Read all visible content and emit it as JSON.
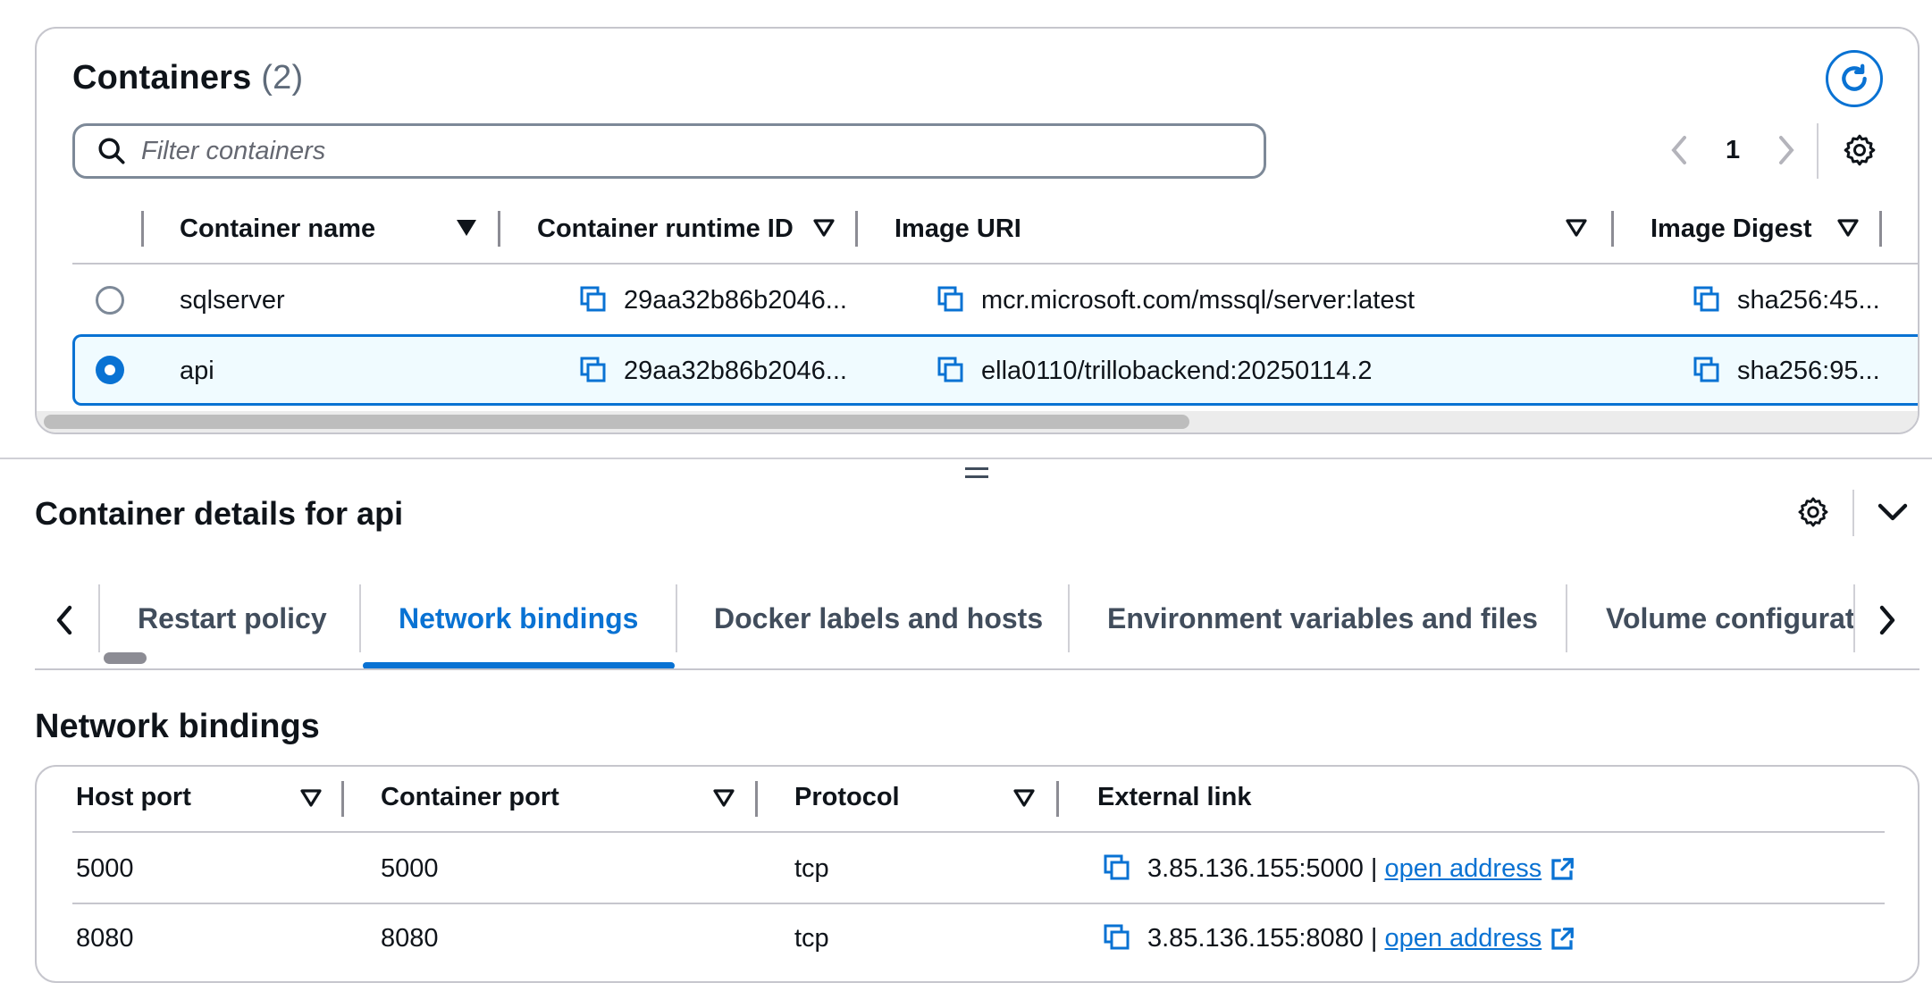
{
  "containers": {
    "title": "Containers",
    "count": "(2)",
    "refresh_icon": "refresh-icon",
    "filter": {
      "placeholder": "Filter containers",
      "value": ""
    },
    "pagination": {
      "current_page": "1"
    },
    "columns": [
      "Container name",
      "Container runtime ID",
      "Image URI",
      "Image Digest"
    ],
    "rows": [
      {
        "selected": false,
        "name": "sqlserver",
        "runtime_id": "29aa32b86b2046...",
        "image_uri": "mcr.microsoft.com/mssql/server:latest",
        "digest": "sha256:45..."
      },
      {
        "selected": true,
        "name": "api",
        "runtime_id": "29aa32b86b2046...",
        "image_uri": "ella0110/trillobackend:20250114.2",
        "digest": "sha256:95..."
      }
    ]
  },
  "details": {
    "title": "Container details for api",
    "tabs": [
      "Restart policy",
      "Network bindings",
      "Docker labels and hosts",
      "Environment variables and files",
      "Volume configurat"
    ],
    "active_tab": "Network bindings"
  },
  "network_bindings": {
    "title": "Network bindings",
    "columns": [
      "Host port",
      "Container port",
      "Protocol",
      "External link"
    ],
    "rows": [
      {
        "host_port": "5000",
        "container_port": "5000",
        "protocol": "tcp",
        "address": "3.85.136.155:5000",
        "separator": "|",
        "link_text": "open address"
      },
      {
        "host_port": "8080",
        "container_port": "8080",
        "protocol": "tcp",
        "address": "3.85.136.155:8080",
        "separator": "|",
        "link_text": "open address"
      }
    ]
  },
  "colors": {
    "accent": "#0972d3",
    "border": "#c6c6cd",
    "text": "#0f141a",
    "muted": "#5f6b7a"
  }
}
